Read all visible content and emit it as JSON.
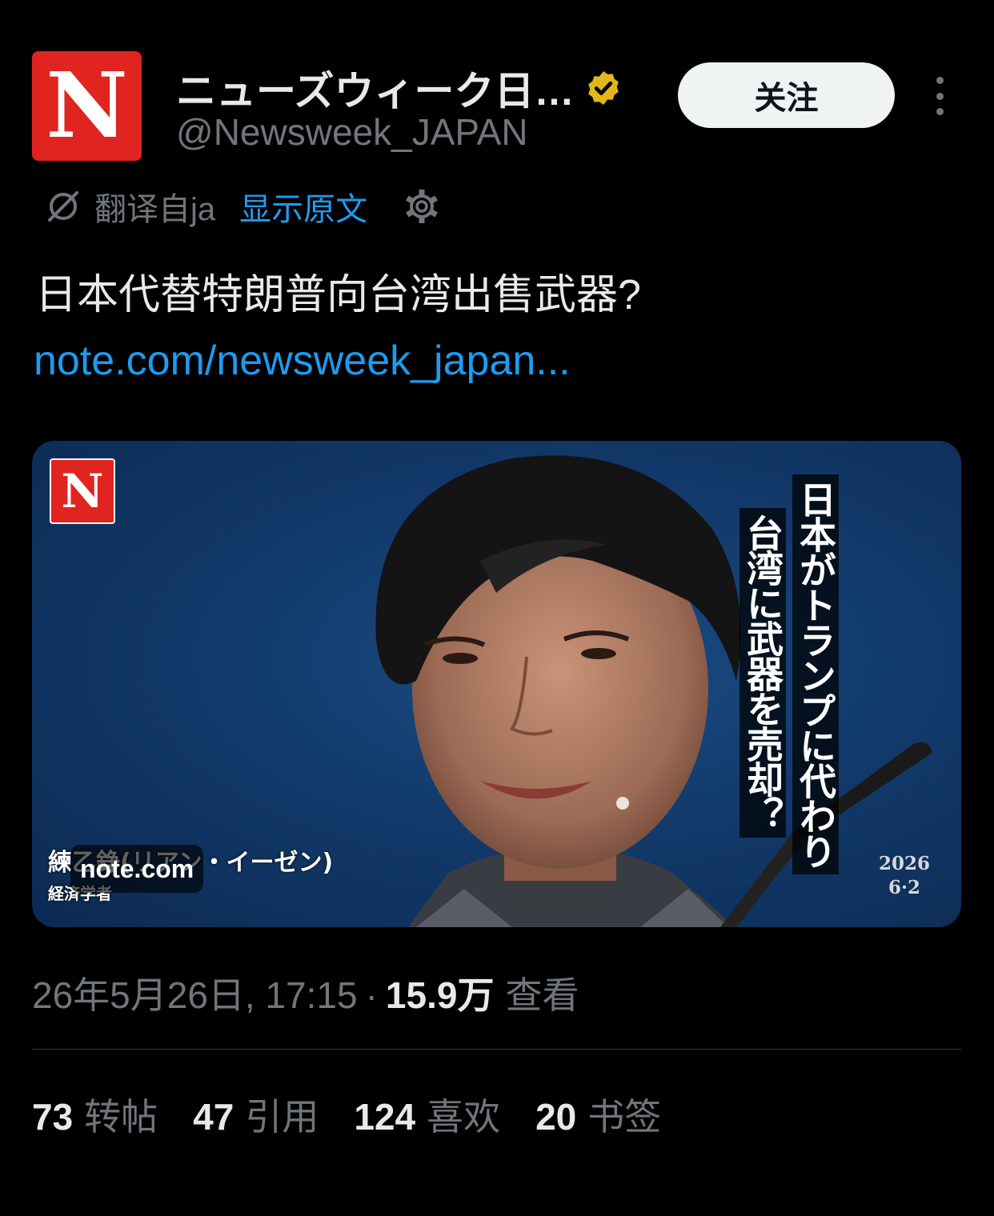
{
  "header": {
    "avatar_letter": "N",
    "display_name": "ニューズウィーク日…",
    "handle": "@Newsweek_JAPAN",
    "follow_label": "关注"
  },
  "translation": {
    "label": "翻译自ja",
    "show_original": "显示原文"
  },
  "post": {
    "text": "日本代替特朗普向台湾出售武器?",
    "link": "note.com/newsweek_japan..."
  },
  "media": {
    "logo_letter": "N",
    "headline_col1": "日本がトランプに代わり",
    "headline_col2": "台湾に武器を売却？",
    "date_year": "2026",
    "date_day": "6·2",
    "author": "練乙錚(リアン・イーゼン)",
    "author_role": "経済学者",
    "domain": "note.com"
  },
  "meta": {
    "timestamp": "26年5月26日, 17:15",
    "separator": "·",
    "views_count": "15.9万",
    "views_label": "查看"
  },
  "stats": {
    "reposts_count": "73",
    "reposts_label": "转帖",
    "quotes_count": "47",
    "quotes_label": "引用",
    "likes_count": "124",
    "likes_label": "喜欢",
    "bookmarks_count": "20",
    "bookmarks_label": "书签"
  },
  "colors": {
    "background": "#000000",
    "accent_link": "#1d9bf0",
    "brand_red": "#e0241f",
    "verified_gold": "#e2b719",
    "muted_text": "#71767b"
  },
  "icons": [
    "verified-badge-icon",
    "more-icon",
    "translate-icon",
    "gear-icon"
  ]
}
